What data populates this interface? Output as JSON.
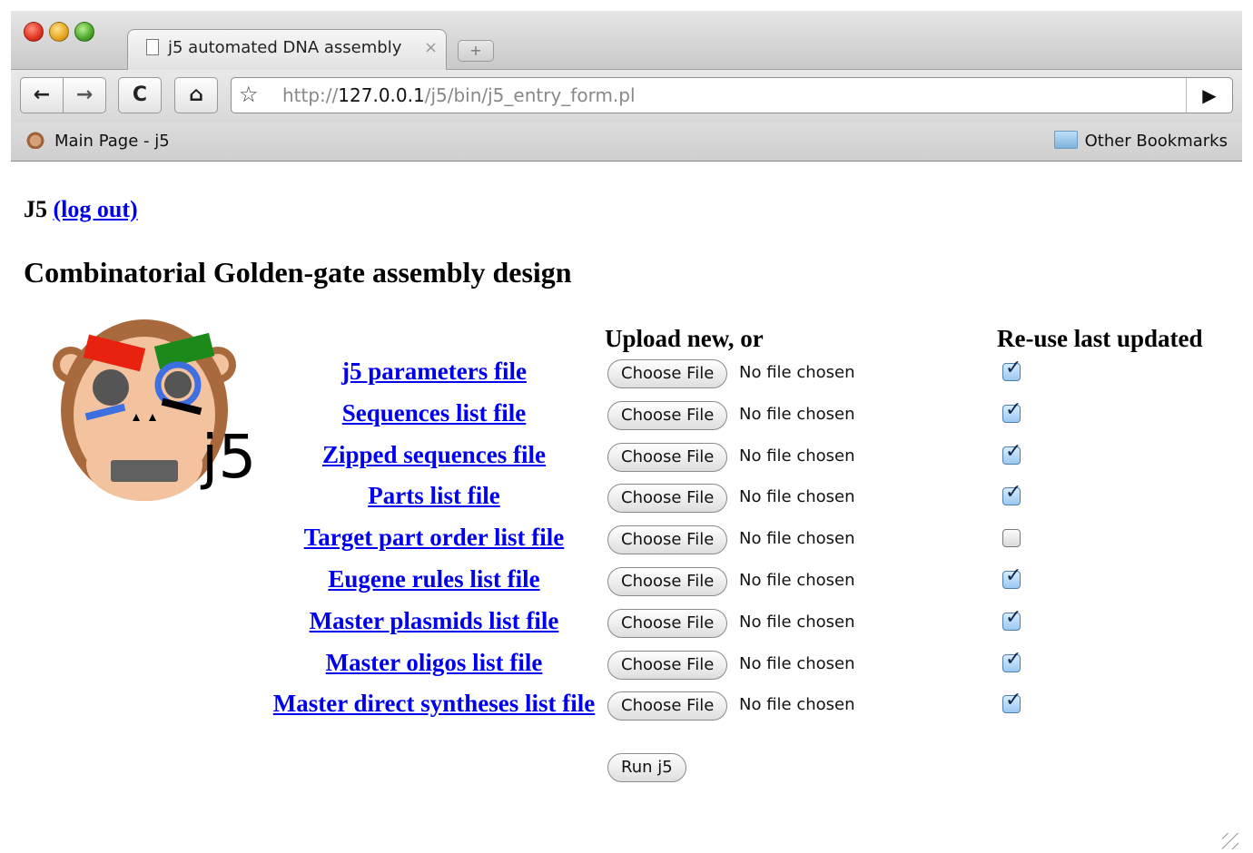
{
  "browser": {
    "tab_title": "j5 automated DNA assembly",
    "tab_close": "×",
    "new_tab": "+",
    "url_scheme": "http://",
    "url_host": "127.0.0.1",
    "url_path": "/j5/bin/j5_entry_form.pl",
    "bookmarks": {
      "left": "Main Page - j5",
      "right": "Other Bookmarks"
    },
    "icons": {
      "back": "←",
      "forward": "→",
      "reload": "C",
      "home": "⌂",
      "star": "☆",
      "go": "▶"
    }
  },
  "page": {
    "user": "J5",
    "logout_label": "(log out)",
    "title": "Combinatorial Golden-gate assembly design",
    "logo_text": "j5",
    "col_upload": "Upload new, or",
    "col_reuse": "Re-use last updated",
    "choose_label": "Choose File",
    "no_file": "No file chosen",
    "run_label": "Run j5",
    "rows": [
      {
        "label": "j5 parameters file",
        "reuse": true
      },
      {
        "label": "Sequences list file",
        "reuse": true
      },
      {
        "label": "Zipped sequences file",
        "reuse": true
      },
      {
        "label": "Parts list file",
        "reuse": true
      },
      {
        "label": "Target part order list file",
        "reuse": false
      },
      {
        "label": "Eugene rules list file",
        "reuse": true
      },
      {
        "label": "Master plasmids list file",
        "reuse": true
      },
      {
        "label": "Master oligos list file",
        "reuse": true
      },
      {
        "label": "Master direct syntheses list file",
        "reuse": true
      }
    ]
  }
}
